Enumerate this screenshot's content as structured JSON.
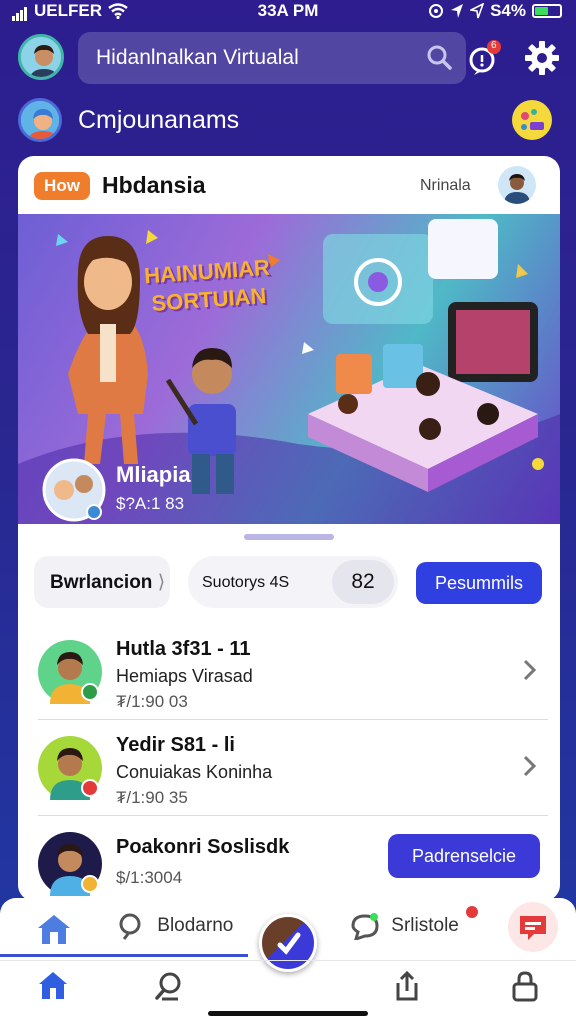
{
  "status_bar": {
    "carrier": "UELFER",
    "time": "33A PM",
    "battery": "S4%",
    "battery_level": 0.54
  },
  "header": {
    "search_placeholder": "Hidanlnalkan Virtualal",
    "notification_count": "6"
  },
  "welcome": {
    "title": "Cmjounanams"
  },
  "card": {
    "badge": "How",
    "title": "Hbdansia",
    "subtitle": "Nrinala",
    "hero_text": "HAINUMIAR SORTUIAN",
    "hero_label": "Mliapia",
    "hero_value": "$?A:1 83"
  },
  "controls": {
    "left_pill": "Bwrlancion",
    "middle_pill_text": "Suotorys 4S",
    "middle_pill_value": "82",
    "primary_button": "Pesummils"
  },
  "list": [
    {
      "title": "Hutla 3f31 - 11",
      "subtitle": "Hemiaps Virasad",
      "meta": "₮/1:90 03"
    },
    {
      "title": "Yedir S81 - li",
      "subtitle": "Conuiakas Koninha",
      "meta": "₮/1:90 35"
    },
    {
      "title": "Poakonri Soslisdk",
      "meta": "$/1:3004",
      "action": "Padrenselcie"
    }
  ],
  "bottom_tabs": {
    "tab1": "Blodarno",
    "tab2": "Srlistole"
  },
  "colors": {
    "accent": "#3b3ad8",
    "badge": "#f07d2b",
    "bg": "#2d1d8f"
  }
}
